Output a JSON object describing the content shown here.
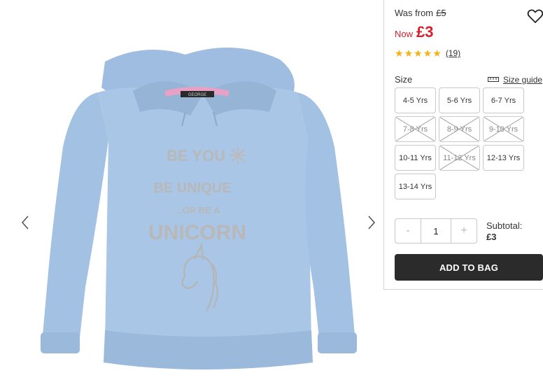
{
  "gallery": {
    "prev_icon": "chevron-left-icon",
    "next_icon": "chevron-right-icon",
    "image": {
      "print_lines": [
        "BE YOU",
        "BE UNIQUE",
        "...OR BE A",
        "UNICORN"
      ],
      "neck_label": "GEORGE",
      "garment_color": "#a9c6e6"
    }
  },
  "pricing": {
    "was_label": "Was from",
    "was_price": "£5",
    "now_label": "Now",
    "now_price": "£3",
    "price_color": "#d3202a"
  },
  "wishlist_icon": "heart-icon",
  "rating": {
    "stars": 5,
    "max_stars": 5,
    "review_count": "(19)",
    "star_color": "#f2b311"
  },
  "size": {
    "label": "Size",
    "guide_label": "Size guide",
    "guide_icon": "ruler-icon",
    "options": [
      {
        "label": "4-5 Yrs",
        "available": true
      },
      {
        "label": "5-6 Yrs",
        "available": true
      },
      {
        "label": "6-7 Yrs",
        "available": true
      },
      {
        "label": "7-8 Yrs",
        "available": false
      },
      {
        "label": "8-9 Yrs",
        "available": false
      },
      {
        "label": "9-10 Yrs",
        "available": false
      },
      {
        "label": "10-11 Yrs",
        "available": true
      },
      {
        "label": "11-12 Yrs",
        "available": false
      },
      {
        "label": "12-13 Yrs",
        "available": true
      },
      {
        "label": "13-14 Yrs",
        "available": true
      }
    ]
  },
  "quantity": {
    "minus": "-",
    "value": "1",
    "plus": "+"
  },
  "subtotal": {
    "label": "Subtotal:",
    "value": "£3"
  },
  "add_to_bag_label": "ADD TO BAG",
  "button_color": "#2b2b2b"
}
